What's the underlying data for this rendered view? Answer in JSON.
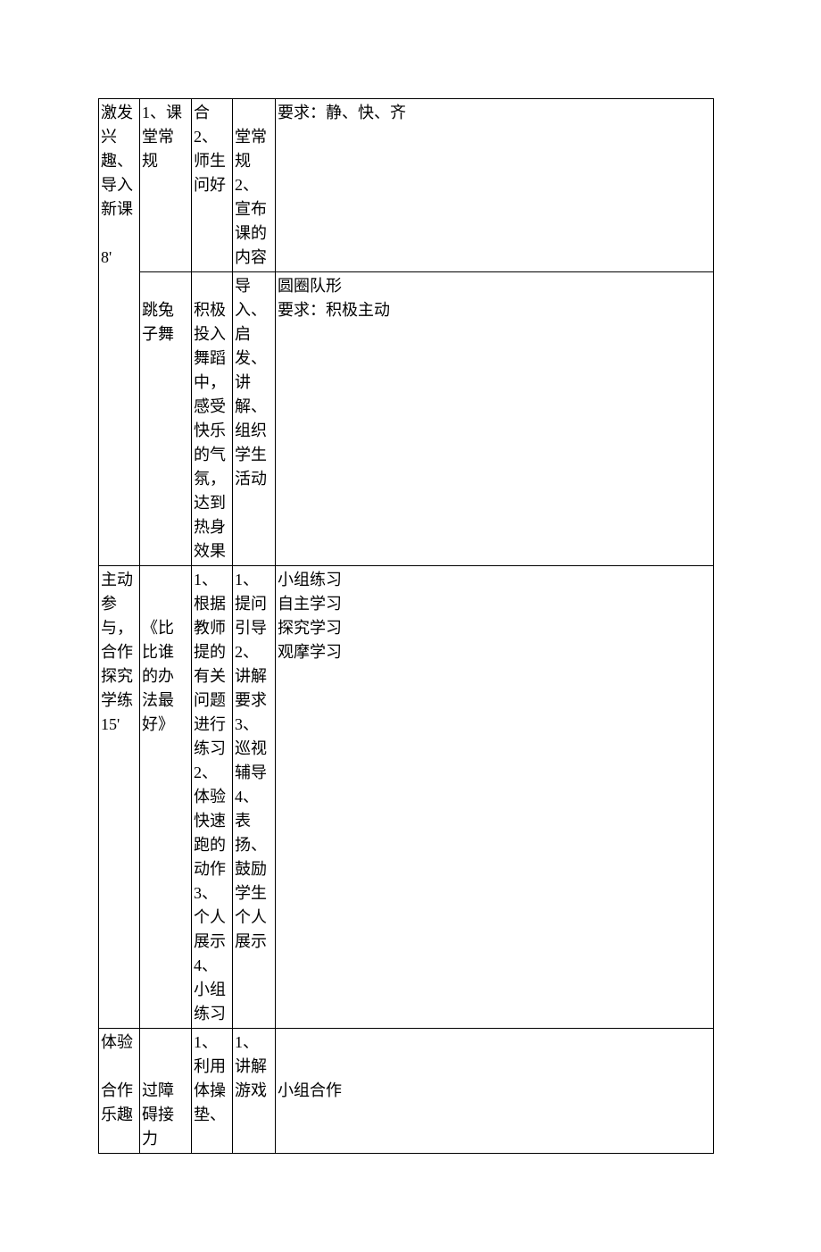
{
  "rows": [
    {
      "c1": "激发兴趣、导入新课\n\n8'",
      "c2": "1、课堂常规",
      "c3": "合\n2、师生问好",
      "c4": "　　堂常规\n2、宣布课的内容",
      "c5": "要求：静、快、齐"
    },
    {
      "c2": "\n跳兔子舞",
      "c3": "　　积极投入舞蹈中，感受快乐的气氛，达到热身效果",
      "c4": "导入、启发、讲解、组织学生活动",
      "c5": "圆圈队形\n要求：积极主动"
    },
    {
      "c1": "主动参与，合作探究学练15'",
      "c2": "\n　　《比比谁的办法最好》",
      "c3": "1、根据教师提的有关问题进行练习\n2、体验快速跑的动作\n3、个人展示\n4、小组练习",
      "c4": "1、提问引导\n2、讲解要求\n3、巡视辅导\n4、表扬、鼓励学生个人展示",
      "c5": "小组练习\n自主学习\n探究学习\n观摩学习"
    },
    {
      "c1": "体验\n\n合作乐趣",
      "c2": "\n\n过障碍接力",
      "c3": "1、利用体操垫、",
      "c4": "1、讲解游戏",
      "c5": "\n\n小组合作"
    }
  ]
}
